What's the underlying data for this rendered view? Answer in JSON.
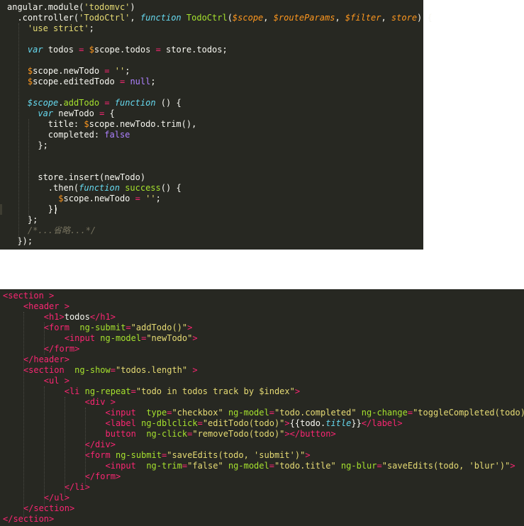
{
  "colors": {
    "editor_background": "#272822",
    "page_background": "#ffffff",
    "plain": "#f8f8f2",
    "string": "#e6db74",
    "keyword": "#f92672",
    "function_name": "#a6e22e",
    "storage": "#66d9ef",
    "parameter": "#fd971f",
    "comment": "#75715e",
    "constant": "#ae81ff"
  },
  "js_editor": {
    "lines": [
      [
        [
          "pl",
          "angular.module("
        ],
        [
          "str",
          "'todomvc'"
        ],
        [
          "pl",
          ")"
        ]
      ],
      [
        [
          "pl",
          "  .controller("
        ],
        [
          "str",
          "'TodoCtrl'"
        ],
        [
          "pl",
          ", "
        ],
        [
          "st",
          "function"
        ],
        [
          "pl",
          " "
        ],
        [
          "fn",
          "TodoCtrl"
        ],
        [
          "pl",
          "("
        ],
        [
          "pm",
          "$scope"
        ],
        [
          "pl",
          ", "
        ],
        [
          "pm",
          "$routeParams"
        ],
        [
          "pl",
          ", "
        ],
        [
          "pm",
          "$filter"
        ],
        [
          "pl",
          ", "
        ],
        [
          "pm",
          "store"
        ],
        [
          "pl",
          ") {"
        ]
      ],
      [
        [
          "pl",
          "    "
        ],
        [
          "str",
          "'use strict'"
        ],
        [
          "pl",
          ";"
        ]
      ],
      [],
      [
        [
          "pl",
          "    "
        ],
        [
          "st",
          "var"
        ],
        [
          "pl",
          " todos "
        ],
        [
          "kw",
          "="
        ],
        [
          "pl",
          " "
        ],
        [
          "var",
          "$"
        ],
        [
          "pl",
          "scope.todos "
        ],
        [
          "kw",
          "="
        ],
        [
          "pl",
          " store.todos;"
        ]
      ],
      [],
      [
        [
          "pl",
          "    "
        ],
        [
          "var",
          "$"
        ],
        [
          "pl",
          "scope.newTodo "
        ],
        [
          "kw",
          "="
        ],
        [
          "pl",
          " "
        ],
        [
          "str",
          "''"
        ],
        [
          "pl",
          ";"
        ]
      ],
      [
        [
          "pl",
          "    "
        ],
        [
          "var",
          "$"
        ],
        [
          "pl",
          "scope.editedTodo "
        ],
        [
          "kw",
          "="
        ],
        [
          "pl",
          " "
        ],
        [
          "num",
          "null"
        ],
        [
          "pl",
          ";"
        ]
      ],
      [],
      [
        [
          "pl",
          "    "
        ],
        [
          "st",
          "$scope"
        ],
        [
          "pl",
          "."
        ],
        [
          "fn",
          "addTodo"
        ],
        [
          "pl",
          " "
        ],
        [
          "kw",
          "="
        ],
        [
          "pl",
          " "
        ],
        [
          "st",
          "function"
        ],
        [
          "pl",
          " () {"
        ]
      ],
      [
        [
          "pl",
          "      "
        ],
        [
          "st",
          "var"
        ],
        [
          "pl",
          " newTodo "
        ],
        [
          "kw",
          "="
        ],
        [
          "pl",
          " {"
        ]
      ],
      [
        [
          "pl",
          "        title: "
        ],
        [
          "var",
          "$"
        ],
        [
          "pl",
          "scope.newTodo.trim(),"
        ]
      ],
      [
        [
          "pl",
          "        completed: "
        ],
        [
          "num",
          "false"
        ]
      ],
      [
        [
          "pl",
          "      };"
        ]
      ],
      [],
      [],
      [
        [
          "pl",
          "      store.insert(newTodo)"
        ]
      ],
      [
        [
          "pl",
          "        .then("
        ],
        [
          "st",
          "function"
        ],
        [
          "pl",
          " "
        ],
        [
          "fn",
          "success"
        ],
        [
          "pl",
          "() {"
        ]
      ],
      [
        [
          "pl",
          "          "
        ],
        [
          "var",
          "$"
        ],
        [
          "pl",
          "scope.newTodo "
        ],
        [
          "kw",
          "="
        ],
        [
          "pl",
          " "
        ],
        [
          "str",
          "''"
        ],
        [
          "pl",
          ";"
        ]
      ],
      [
        [
          "pl",
          "        })"
        ]
      ],
      [
        [
          "pl",
          "    };"
        ]
      ],
      [
        [
          "pl",
          "    "
        ],
        [
          "cm",
          "/*...省略...*/"
        ]
      ],
      [
        [
          "pl",
          "  });"
        ]
      ]
    ]
  },
  "html_editor": {
    "lines": [
      [
        [
          "ang",
          "<"
        ],
        [
          "tag",
          "section"
        ],
        [
          "pl",
          " "
        ],
        [
          "ang",
          ">"
        ]
      ],
      [
        [
          "pl",
          "    "
        ],
        [
          "ang",
          "<"
        ],
        [
          "tag",
          "header"
        ],
        [
          "pl",
          " "
        ],
        [
          "ang",
          ">"
        ]
      ],
      [
        [
          "pl",
          "        "
        ],
        [
          "ang",
          "<"
        ],
        [
          "tag",
          "h1"
        ],
        [
          "ang",
          ">"
        ],
        [
          "pl",
          "todos"
        ],
        [
          "ang",
          "</"
        ],
        [
          "tag",
          "h1"
        ],
        [
          "ang",
          ">"
        ]
      ],
      [
        [
          "pl",
          "        "
        ],
        [
          "ang",
          "<"
        ],
        [
          "tag",
          "form"
        ],
        [
          "pl",
          "  "
        ],
        [
          "att",
          "ng-submit"
        ],
        [
          "kw",
          "="
        ],
        [
          "str",
          "\"addTodo()\""
        ],
        [
          "ang",
          ">"
        ]
      ],
      [
        [
          "pl",
          "            "
        ],
        [
          "ang",
          "<"
        ],
        [
          "tag",
          "input"
        ],
        [
          "pl",
          " "
        ],
        [
          "att",
          "ng-model"
        ],
        [
          "kw",
          "="
        ],
        [
          "str",
          "\"newTodo\""
        ],
        [
          "ang",
          ">"
        ]
      ],
      [
        [
          "pl",
          "        "
        ],
        [
          "ang",
          "</"
        ],
        [
          "tag",
          "form"
        ],
        [
          "ang",
          ">"
        ]
      ],
      [
        [
          "pl",
          "    "
        ],
        [
          "ang",
          "</"
        ],
        [
          "tag",
          "header"
        ],
        [
          "ang",
          ">"
        ]
      ],
      [
        [
          "pl",
          "    "
        ],
        [
          "ang",
          "<"
        ],
        [
          "tag",
          "section"
        ],
        [
          "pl",
          "  "
        ],
        [
          "att",
          "ng-show"
        ],
        [
          "kw",
          "="
        ],
        [
          "str",
          "\"todos.length\""
        ],
        [
          "pl",
          " "
        ],
        [
          "ang",
          ">"
        ]
      ],
      [
        [
          "pl",
          "        "
        ],
        [
          "ang",
          "<"
        ],
        [
          "tag",
          "ul"
        ],
        [
          "pl",
          " "
        ],
        [
          "ang",
          ">"
        ]
      ],
      [
        [
          "pl",
          "            "
        ],
        [
          "ang",
          "<"
        ],
        [
          "tag",
          "li"
        ],
        [
          "pl",
          " "
        ],
        [
          "att",
          "ng-repeat"
        ],
        [
          "kw",
          "="
        ],
        [
          "str",
          "\"todo in todos track by $index\""
        ],
        [
          "ang",
          ">"
        ]
      ],
      [
        [
          "pl",
          "                "
        ],
        [
          "ang",
          "<"
        ],
        [
          "tag",
          "div"
        ],
        [
          "pl",
          " "
        ],
        [
          "ang",
          ">"
        ]
      ],
      [
        [
          "pl",
          "                    "
        ],
        [
          "ang",
          "<"
        ],
        [
          "tag",
          "input"
        ],
        [
          "pl",
          "  "
        ],
        [
          "att",
          "type"
        ],
        [
          "kw",
          "="
        ],
        [
          "str",
          "\"checkbox\""
        ],
        [
          "pl",
          " "
        ],
        [
          "att",
          "ng-model"
        ],
        [
          "kw",
          "="
        ],
        [
          "str",
          "\"todo.completed\""
        ],
        [
          "pl",
          " "
        ],
        [
          "att",
          "ng-change"
        ],
        [
          "kw",
          "="
        ],
        [
          "str",
          "\"toggleCompleted(todo)\""
        ],
        [
          "ang",
          ">"
        ]
      ],
      [
        [
          "pl",
          "                    "
        ],
        [
          "ang",
          "<"
        ],
        [
          "tag",
          "label"
        ],
        [
          "pl",
          " "
        ],
        [
          "att",
          "ng-dblclick"
        ],
        [
          "kw",
          "="
        ],
        [
          "str",
          "\"editTodo(todo)\""
        ],
        [
          "ang",
          ">"
        ],
        [
          "pl",
          "{{todo."
        ],
        [
          "st",
          "title"
        ],
        [
          "pl",
          "}}"
        ],
        [
          "ang",
          "</"
        ],
        [
          "tag",
          "label"
        ],
        [
          "ang",
          ">"
        ]
      ],
      [
        [
          "pl",
          "                    "
        ],
        [
          "tag",
          "button"
        ],
        [
          "pl",
          "  "
        ],
        [
          "att",
          "ng-click"
        ],
        [
          "kw",
          "="
        ],
        [
          "str",
          "\"removeTodo(todo)\""
        ],
        [
          "ang",
          "></"
        ],
        [
          "tag",
          "button"
        ],
        [
          "ang",
          ">"
        ]
      ],
      [
        [
          "pl",
          "                "
        ],
        [
          "ang",
          "</"
        ],
        [
          "tag",
          "div"
        ],
        [
          "ang",
          ">"
        ]
      ],
      [
        [
          "pl",
          "                "
        ],
        [
          "ang",
          "<"
        ],
        [
          "tag",
          "form"
        ],
        [
          "pl",
          " "
        ],
        [
          "att",
          "ng-submit"
        ],
        [
          "kw",
          "="
        ],
        [
          "str",
          "\"saveEdits(todo, 'submit')\""
        ],
        [
          "ang",
          ">"
        ]
      ],
      [
        [
          "pl",
          "                    "
        ],
        [
          "ang",
          "<"
        ],
        [
          "tag",
          "input"
        ],
        [
          "pl",
          "  "
        ],
        [
          "att",
          "ng-trim"
        ],
        [
          "kw",
          "="
        ],
        [
          "str",
          "\"false\""
        ],
        [
          "pl",
          " "
        ],
        [
          "att",
          "ng-model"
        ],
        [
          "kw",
          "="
        ],
        [
          "str",
          "\"todo.title\""
        ],
        [
          "pl",
          " "
        ],
        [
          "att",
          "ng-blur"
        ],
        [
          "kw",
          "="
        ],
        [
          "str",
          "\"saveEdits(todo, 'blur')\""
        ],
        [
          "ang",
          ">"
        ]
      ],
      [
        [
          "pl",
          "                "
        ],
        [
          "ang",
          "</"
        ],
        [
          "tag",
          "form"
        ],
        [
          "ang",
          ">"
        ]
      ],
      [
        [
          "pl",
          "            "
        ],
        [
          "ang",
          "</"
        ],
        [
          "tag",
          "li"
        ],
        [
          "ang",
          ">"
        ]
      ],
      [
        [
          "pl",
          "        "
        ],
        [
          "ang",
          "</"
        ],
        [
          "tag",
          "ul"
        ],
        [
          "ang",
          ">"
        ]
      ],
      [
        [
          "pl",
          "    "
        ],
        [
          "ang",
          "</"
        ],
        [
          "tag",
          "section"
        ],
        [
          "ang",
          ">"
        ]
      ],
      [
        [
          "ang",
          "</"
        ],
        [
          "tag",
          "section"
        ],
        [
          "ang",
          ">"
        ]
      ]
    ]
  }
}
